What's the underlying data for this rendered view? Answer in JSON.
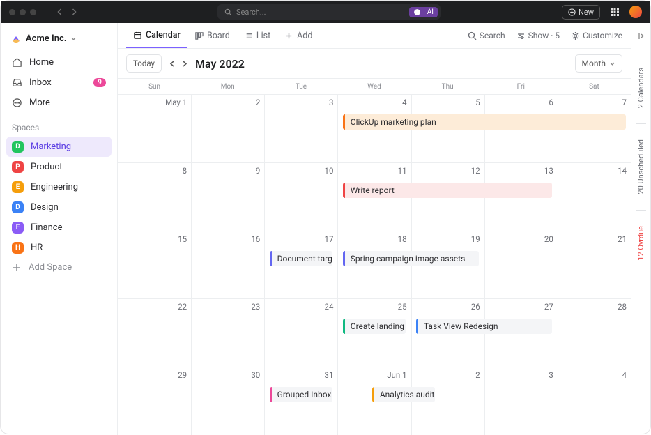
{
  "topbar": {
    "search_placeholder": "Search...",
    "ai_label": "AI",
    "new_label": "New"
  },
  "workspace": {
    "name": "Acme Inc."
  },
  "nav": {
    "home": "Home",
    "inbox": "Inbox",
    "inbox_badge": "9",
    "more": "More"
  },
  "spaces_label": "Spaces",
  "spaces": [
    {
      "letter": "D",
      "name": "Marketing",
      "color": "#22c55e",
      "active": true
    },
    {
      "letter": "P",
      "name": "Product",
      "color": "#ef4444"
    },
    {
      "letter": "E",
      "name": "Engineering",
      "color": "#f59e0b"
    },
    {
      "letter": "D",
      "name": "Design",
      "color": "#3b82f6"
    },
    {
      "letter": "F",
      "name": "Finance",
      "color": "#8b5cf6"
    },
    {
      "letter": "H",
      "name": "HR",
      "color": "#f97316"
    }
  ],
  "add_space": "Add Space",
  "views": {
    "calendar": "Calendar",
    "board": "Board",
    "list": "List",
    "add": "Add"
  },
  "viewbar_right": {
    "search": "Search",
    "show": "Show · 5",
    "customize": "Customize"
  },
  "calendar": {
    "today": "Today",
    "title": "May 2022",
    "granularity": "Month",
    "dow": [
      "Sun",
      "Mon",
      "Tue",
      "Wed",
      "Thu",
      "Fri",
      "Sat"
    ],
    "weeks": [
      {
        "days": [
          "May 1",
          "2",
          "3",
          "4",
          "5",
          "6",
          "7"
        ],
        "events": [
          {
            "start": 3,
            "span": 4,
            "color": "#f97316",
            "bg": "#fdecd8",
            "label": "ClickUp marketing plan"
          }
        ]
      },
      {
        "days": [
          "8",
          "9",
          "10",
          "11",
          "12",
          "13",
          "14"
        ],
        "events": [
          {
            "start": 3,
            "span": 3,
            "color": "#ef4444",
            "bg": "#fce8e8",
            "label": "Write report"
          }
        ]
      },
      {
        "days": [
          "15",
          "16",
          "17",
          "18",
          "19",
          "20",
          "21"
        ],
        "events": [
          {
            "start": 2,
            "span": 1,
            "color": "#6366f1",
            "bg": "#f4f5f7",
            "label": "Document target users"
          },
          {
            "start": 3,
            "span": 2,
            "color": "#6366f1",
            "bg": "#f4f5f7",
            "label": "Spring campaign image assets"
          }
        ]
      },
      {
        "days": [
          "22",
          "23",
          "24",
          "25",
          "26",
          "27",
          "28"
        ],
        "events": [
          {
            "start": 3,
            "span": 1,
            "color": "#10b981",
            "bg": "#f4f5f7",
            "label": "Create landing page"
          },
          {
            "start": 4,
            "span": 2,
            "color": "#3b82f6",
            "bg": "#f4f5f7",
            "label": "Task View Redesign"
          }
        ]
      },
      {
        "days": [
          "29",
          "30",
          "31",
          "Jun 1",
          "2",
          "3",
          "4"
        ],
        "events": [
          {
            "start": 2,
            "span": 1,
            "color": "#ec4899",
            "bg": "#f4f5f7",
            "label": "Grouped Inbox Comments"
          },
          {
            "start": 3.4,
            "span": 1,
            "color": "#f59e0b",
            "bg": "#f4f5f7",
            "label": "Analytics audit"
          }
        ]
      }
    ]
  },
  "rail": {
    "calendars": "2 Calendars",
    "unscheduled": "20 Unscheduled",
    "overdue": "12 Ovrdue"
  }
}
